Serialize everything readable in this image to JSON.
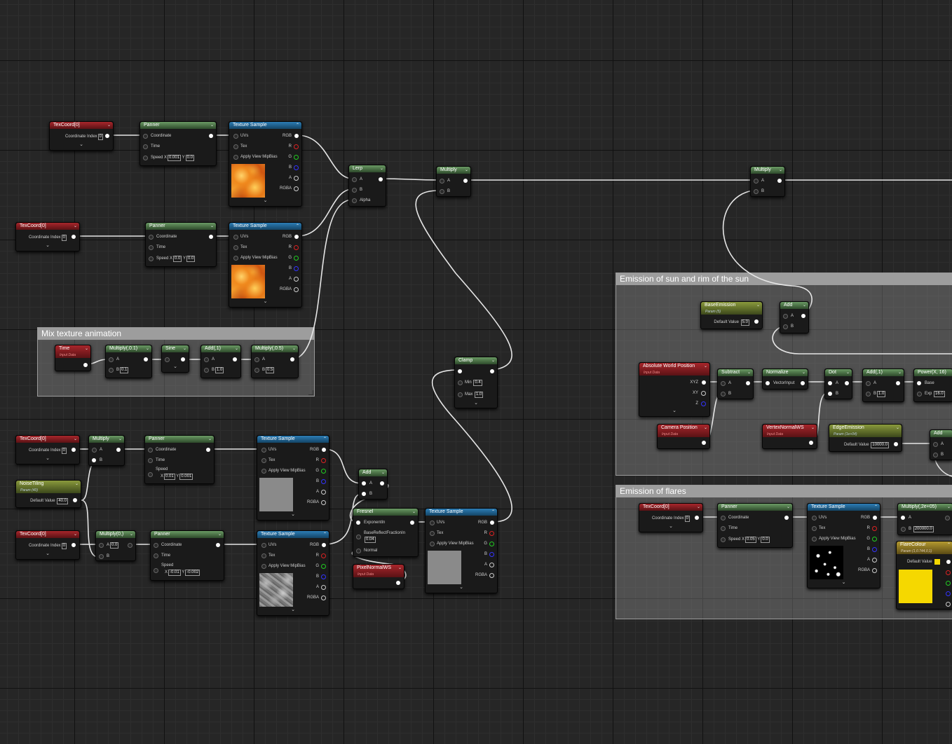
{
  "comments": {
    "mix": "Mix texture animation",
    "sun": "Emission of sun and rim of the sun",
    "flares": "Emission of flares"
  },
  "labels": {
    "texcoord": "TexCoord[0]",
    "coord_index": "Coordinate Index",
    "panner": "Panner",
    "coordinate": "Coordinate",
    "time": "Time",
    "speed": "Speed",
    "texture_sample": "Texture Sample",
    "uvs": "UVs",
    "tex": "Tex",
    "apply_view_mip_bias": "Apply View MipBias",
    "rgb": "RGB",
    "r": "R",
    "g": "G",
    "b": "B",
    "a": "A",
    "rgba": "RGBA",
    "lerp": "Lerp",
    "multiply": "Multiply",
    "add": "Add",
    "alpha": "Alpha",
    "pin_a": "A",
    "pin_b": "B",
    "x": "X",
    "y": "Y",
    "input_data": "Input Data",
    "default_value": "Default Value",
    "min": "Min",
    "max": "Max",
    "exp": "Exp",
    "base": "Base",
    "xyz": "XYZ",
    "xy": "XY",
    "z": "Z",
    "vector_input": "VectorInput",
    "exponent_in": "ExponentIn",
    "base_reflect": "BaseReflectFractionIn",
    "normal": "Normal"
  },
  "nodes": {
    "tc1": {
      "index": "0"
    },
    "tc2": {
      "index": "0"
    },
    "tc3": {
      "index": "0"
    },
    "tc4": {
      "index": "0"
    },
    "tc5": {
      "index": "0"
    },
    "p1": {
      "sx": "0.001",
      "sy": "0.0"
    },
    "p2": {
      "sx": "0.0",
      "sy": "0.0"
    },
    "p3": {
      "sx": "0.01",
      "sy": "0.001"
    },
    "p4": {
      "sx": "-0.01",
      "sy": "-0.002"
    },
    "p5": {
      "sx": "0.05",
      "sy": "0.0"
    },
    "time": {
      "title": "Time"
    },
    "mul01": {
      "title": "Multiply(,0.1)",
      "b": "0.1"
    },
    "sine": {
      "title": "Sine"
    },
    "add1": {
      "title": "Add(,1)",
      "b": "1.0"
    },
    "mul05": {
      "title": "Multiply(,0.5)",
      "b": "0.5"
    },
    "noise": {
      "title": "NoiseTiling",
      "sub": "Param (40)",
      "value": "40.0"
    },
    "mul0": {
      "title": "Multiply(0,)",
      "a": "0.0"
    },
    "fresnel": {
      "title": "Fresnel",
      "bf": "0.04"
    },
    "pixn": {
      "title": "PixelNormalWS"
    },
    "clamp": {
      "title": "Clamp",
      "min": "0.4",
      "max": "1.0"
    },
    "base_em": {
      "title": "BaseEmission",
      "sub": "Param (5)",
      "value": "5.0"
    },
    "awp": {
      "title": "Absolute World Position"
    },
    "cam": {
      "title": "Camera Position"
    },
    "subtract": {
      "title": "Subtract"
    },
    "normalize": {
      "title": "Normalize"
    },
    "dot": {
      "title": "Dot"
    },
    "add_1b": {
      "title": "Add(,1)",
      "b": "1.0"
    },
    "power": {
      "title": "Power(X, 16)",
      "exp": "16.0"
    },
    "vnws": {
      "title": "VertexNormalWS"
    },
    "edge": {
      "title": "EdgeEmission",
      "sub": "Param (1e+04)",
      "value": "10000.0"
    },
    "mulbig": {
      "title": "Multiply(,2e+05)",
      "b": "200000.0"
    },
    "flare": {
      "title": "FlareColour",
      "sub": "Param (1,0.744,0,1)",
      "color": "#f5d800"
    }
  },
  "colors": {
    "wire": "#e6e6e6",
    "flare_swatch": "#f5d800"
  }
}
